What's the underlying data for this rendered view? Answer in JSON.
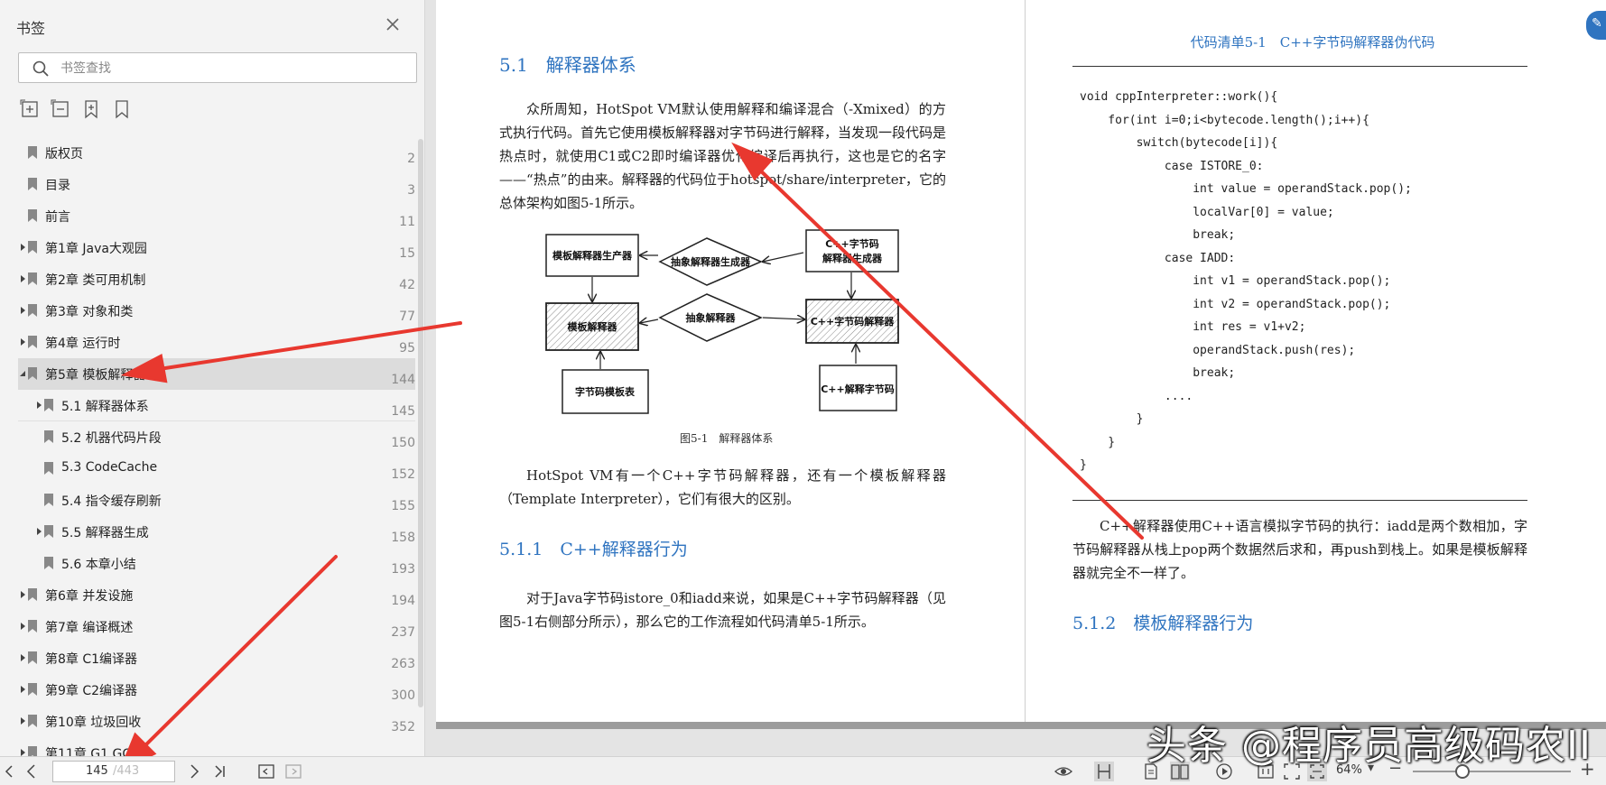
{
  "sidebar": {
    "title": "书签",
    "search_placeholder": "书签查找",
    "items": [
      {
        "label": "版权页",
        "page": "2",
        "level": 0,
        "expander": "none"
      },
      {
        "label": "目录",
        "page": "3",
        "level": 0,
        "expander": "none"
      },
      {
        "label": "前言",
        "page": "11",
        "level": 0,
        "expander": "none"
      },
      {
        "label": "第1章 Java大观园",
        "page": "15",
        "level": 0,
        "expander": "collapsed"
      },
      {
        "label": "第2章 类可用机制",
        "page": "42",
        "level": 0,
        "expander": "collapsed"
      },
      {
        "label": "第3章 对象和类",
        "page": "77",
        "level": 0,
        "expander": "collapsed"
      },
      {
        "label": "第4章 运行时",
        "page": "95",
        "level": 0,
        "expander": "collapsed"
      },
      {
        "label": "第5章 模板解释器",
        "page": "144",
        "level": 0,
        "expander": "expanded",
        "selected": true
      },
      {
        "label": "5.1 解释器体系",
        "page": "145",
        "level": 1,
        "expander": "collapsed"
      },
      {
        "label": "5.2 机器代码片段",
        "page": "150",
        "level": 1,
        "expander": "none"
      },
      {
        "label": "5.3 CodeCache",
        "page": "152",
        "level": 1,
        "expander": "none"
      },
      {
        "label": "5.4 指令缓存刷新",
        "page": "155",
        "level": 1,
        "expander": "none"
      },
      {
        "label": "5.5 解释器生成",
        "page": "158",
        "level": 1,
        "expander": "collapsed"
      },
      {
        "label": "5.6 本章小结",
        "page": "193",
        "level": 1,
        "expander": "none"
      },
      {
        "label": "第6章 并发设施",
        "page": "194",
        "level": 0,
        "expander": "collapsed"
      },
      {
        "label": "第7章 编译概述",
        "page": "237",
        "level": 0,
        "expander": "collapsed"
      },
      {
        "label": "第8章 C1编译器",
        "page": "263",
        "level": 0,
        "expander": "collapsed"
      },
      {
        "label": "第9章 C2编译器",
        "page": "300",
        "level": 0,
        "expander": "collapsed"
      },
      {
        "label": "第10章 垃圾回收",
        "page": "352",
        "level": 0,
        "expander": "collapsed"
      },
      {
        "label": "第11章 G1 GC",
        "page": "",
        "level": 0,
        "expander": "collapsed"
      }
    ]
  },
  "left_page": {
    "section_title": "5.1　解释器体系",
    "para1": "众所周知，HotSpot VM默认使用解释和编译混合（-Xmixed）的方式执行代码。首先它使用模板解释器对字节码进行解释，当发现一段代码是热点时，就使用C1或C2即时编译器优化编译后再执行，这也是它的名字——“热点”的由来。解释器的代码位于hotspot/share/interpreter，它的总体架构如图5-1所示。",
    "figure": {
      "boxes": {
        "tpl_gen": "模板解释器生产器",
        "abs_gen": "抽象解释器生成器",
        "cpp_gen_l1": "C++字节码",
        "cpp_gen_l2": "解释器生成器",
        "tpl_interp": "模板解释器",
        "abs_interp": "抽象解释器",
        "cpp_interp": "C++字节码解释器",
        "bytecode_table": "字节码模板表",
        "cpp_bytecode": "C++解释字节码"
      },
      "caption": "图5-1　解释器体系"
    },
    "para2": "HotSpot VM有一个C++字节码解释器，还有一个模板解释器（Template Interpreter），它们有很大的区别。",
    "subsection_title": "5.1.1　C++解释器行为",
    "para3": "对于Java字节码istore_0和iadd来说，如果是C++字节码解释器（见图5-1右侧部分所示），那么它的工作流程如代码清单5-1所示。"
  },
  "right_page": {
    "listing_title": "代码清单5-1　C++字节码解释器伪代码",
    "code": "void cppInterpreter::work(){\n    for(int i=0;i<bytecode.length();i++){\n        switch(bytecode[i]){\n            case ISTORE_0:\n                int value = operandStack.pop();\n                localVar[0] = value;\n                break;\n            case IADD:\n                int v1 = operandStack.pop();\n                int v2 = operandStack.pop();\n                int res = v1+v2;\n                operandStack.push(res);\n                break;\n            ....\n        }\n    }\n}",
    "para1": "C++解释器使用C++语言模拟字节码的执行：iadd是两个数相加，字节码解释器从栈上pop两个数据然后求和，再push到栈上。如果是模板解释器就完全不一样了。",
    "subsection_title": "5.1.2　模板解释器行为"
  },
  "statusbar": {
    "current_page": "145",
    "total_pages": "/443",
    "zoom": "64%"
  },
  "watermark": "头条 @程序员高级码农II",
  "colors": {
    "accent": "#2f74c0",
    "arrow": "#e8382f",
    "selected_row": "#dcdcdc"
  }
}
